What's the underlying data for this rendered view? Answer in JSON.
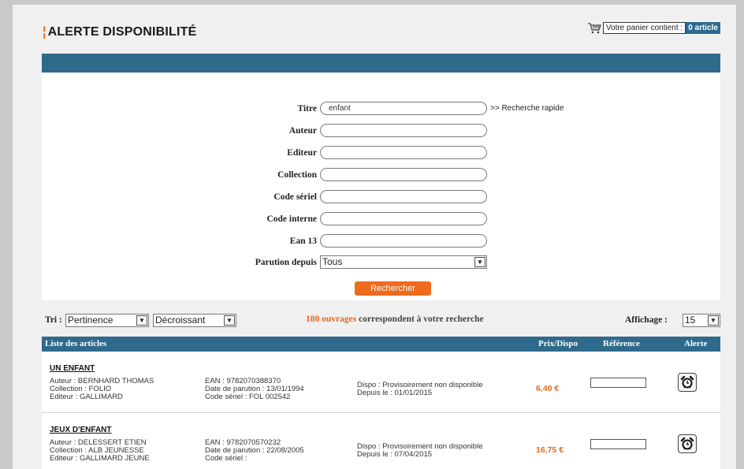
{
  "header": {
    "title_mark": "¦",
    "title": "ALERTE DISPONIBILITÉ",
    "cart_text": "Votre panier contient :",
    "cart_count": "0 article"
  },
  "search": {
    "fields": [
      {
        "label": "Titre",
        "value": "enfant"
      },
      {
        "label": "Auteur",
        "value": ""
      },
      {
        "label": "Editeur",
        "value": ""
      },
      {
        "label": "Collection",
        "value": ""
      },
      {
        "label": "Code sériel",
        "value": ""
      },
      {
        "label": "Code interne",
        "value": ""
      },
      {
        "label": "Ean 13",
        "value": ""
      }
    ],
    "quick_link": ">> Recherche rapide",
    "parution_label": "Parution depuis",
    "parution_value": "Tous",
    "button_label": "Rechercher"
  },
  "sort": {
    "label": "Tri :",
    "sort_by": "Pertinence",
    "order": "Décroissant",
    "results_num": "180 ouvrages",
    "results_text": " correspondent à votre recherche",
    "display_label": "Affichage :",
    "display_value": "15"
  },
  "table": {
    "headers": {
      "list": "Liste des articles",
      "price": "Prix/Dispo",
      "reference": "Référence",
      "alert": "Alerte"
    },
    "rows": [
      {
        "title": "UN ENFANT",
        "author": "Auteur : BERNHARD THOMAS",
        "collection": "Collection : FOLIO",
        "editor": "Editeur : GALLIMARD",
        "ean": "EAN : 9782070388370",
        "date": "Date de parution : 13/01/1994",
        "serial": "Code sériel : FOL 002542",
        "dispo": "Dispo : Provisoirement non disponible",
        "since": "Depuis le : 01/01/2015",
        "price": "6,40 €"
      },
      {
        "title": "JEUX D'ENFANT",
        "author": "Auteur : DELESSERT ETIEN",
        "collection": "Collection : ALB JEUNESSE",
        "editor": "Editeur : GALLIMARD JEUNE",
        "ean": "EAN : 9782070570232",
        "date": "Date de parution : 22/08/2005",
        "serial": "Code sériel :",
        "dispo": "Dispo : Provisoirement non disponible",
        "since": "Depuis le : 07/04/2015",
        "price": "16,75 €"
      }
    ]
  },
  "colors": {
    "accent": "#ee6a1d",
    "header_blue": "#2f6a8c"
  }
}
